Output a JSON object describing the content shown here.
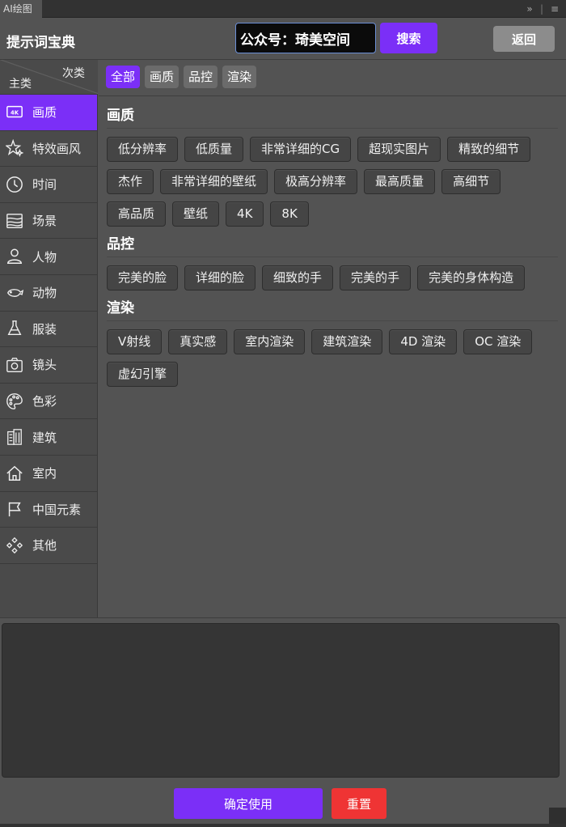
{
  "panel": {
    "tab_label": "AI绘图",
    "collapse_glyph": "»",
    "separator_glyph": "|",
    "menu_glyph": "≡"
  },
  "header": {
    "title": "提示词宝典",
    "search_value": "公众号：琦美空间",
    "search_label": "搜索",
    "back_label": "返回"
  },
  "sidebar": {
    "corner_sub": "次类",
    "corner_main": "主类",
    "items": [
      {
        "label": "画质",
        "icon": "4k-icon",
        "active": true
      },
      {
        "label": "特效画风",
        "icon": "sparkle-icon"
      },
      {
        "label": "时间",
        "icon": "clock-icon"
      },
      {
        "label": "场景",
        "icon": "landscape-icon"
      },
      {
        "label": "人物",
        "icon": "person-icon"
      },
      {
        "label": "动物",
        "icon": "animal-icon"
      },
      {
        "label": "服装",
        "icon": "hanger-icon"
      },
      {
        "label": "镜头",
        "icon": "camera-icon"
      },
      {
        "label": "色彩",
        "icon": "palette-icon"
      },
      {
        "label": "建筑",
        "icon": "building-icon"
      },
      {
        "label": "室内",
        "icon": "house-icon"
      },
      {
        "label": "中国元素",
        "icon": "flag-icon"
      },
      {
        "label": "其他",
        "icon": "diamonds-icon"
      }
    ]
  },
  "tabs": [
    "全部",
    "画质",
    "品控",
    "渲染"
  ],
  "sections": [
    {
      "title": "画质",
      "chips": [
        "低分辨率",
        "低质量",
        "非常详细的CG",
        "超现实图片",
        "精致的细节",
        "杰作",
        "非常详细的壁纸",
        "极高分辨率",
        "最高质量",
        "高细节",
        "高品质",
        "壁纸",
        "4K",
        "8K"
      ]
    },
    {
      "title": "品控",
      "chips": [
        "完美的脸",
        "详细的脸",
        "细致的手",
        "完美的手",
        "完美的身体构造"
      ]
    },
    {
      "title": "渲染",
      "chips": [
        "V射线",
        "真实感",
        "室内渲染",
        "建筑渲染",
        "4D 渲染",
        "OC 渲染",
        "虚幻引擎"
      ]
    }
  ],
  "prompt": {
    "value": ""
  },
  "footer": {
    "confirm_label": "确定使用",
    "reset_label": "重置"
  },
  "colors": {
    "accent": "#7b2ff7",
    "danger": "#ef3434",
    "panel_bg": "#535353"
  }
}
